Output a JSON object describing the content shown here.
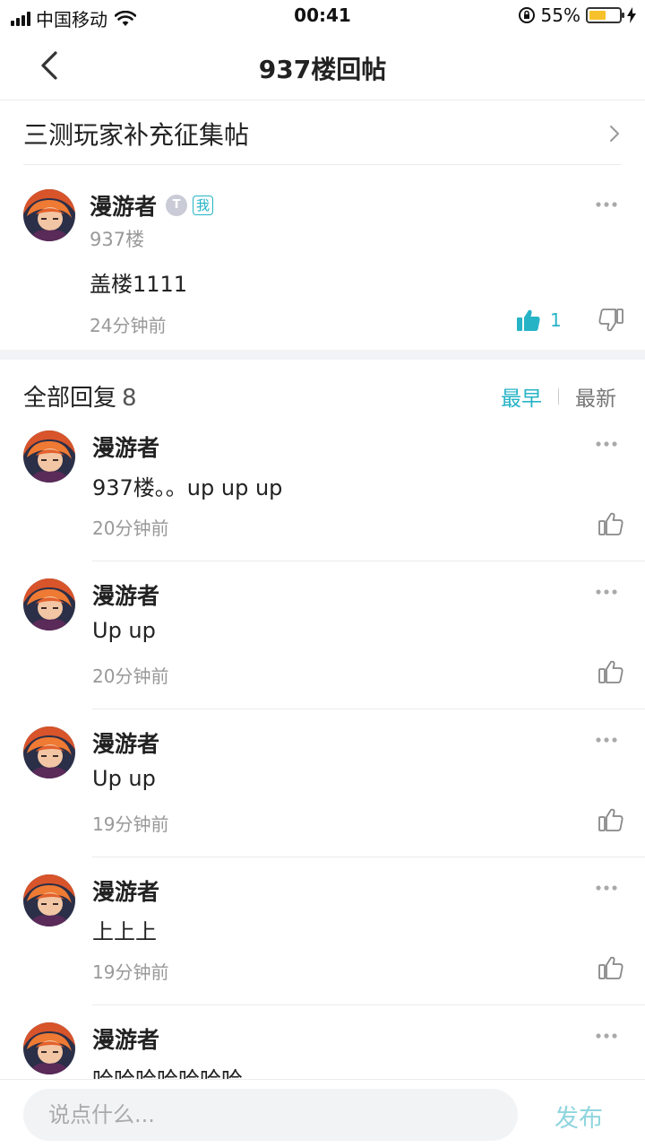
{
  "status_bar": {
    "carrier": "中国移动",
    "time": "00:41",
    "battery": "55%",
    "battery_level": 0.55,
    "icons": [
      "signal-icon",
      "wifi-icon",
      "orientation-lock-icon",
      "battery-icon",
      "charging-icon"
    ]
  },
  "nav": {
    "title": "937楼回帖",
    "back_icon": "chevron-left-icon"
  },
  "topic": {
    "title": "三测玩家补充征集帖",
    "icon": "chevron-right-icon"
  },
  "main_post": {
    "user_name": "漫游者",
    "level_badge": "T",
    "me_badge": "我",
    "floor": "937楼",
    "content": "盖楼1111",
    "time": "24分钟前",
    "like_count": "1",
    "colors": {
      "accent": "#26b3c6"
    }
  },
  "replies_header": {
    "title": "全部回复",
    "count": "8",
    "sort_earliest": "最早",
    "sort_latest": "最新"
  },
  "replies": [
    {
      "user_name": "漫游者",
      "content": "937楼。。up up up",
      "time": "20分钟前"
    },
    {
      "user_name": "漫游者",
      "content": "Up up",
      "time": "20分钟前"
    },
    {
      "user_name": "漫游者",
      "content": "Up up",
      "time": "19分钟前"
    },
    {
      "user_name": "漫游者",
      "content": "上上上",
      "time": "19分钟前"
    },
    {
      "user_name": "漫游者",
      "content": "哈哈哈哈哈哈哈",
      "time": ""
    }
  ],
  "composer": {
    "placeholder": "说点什么...",
    "value": "",
    "publish_label": "发布"
  }
}
